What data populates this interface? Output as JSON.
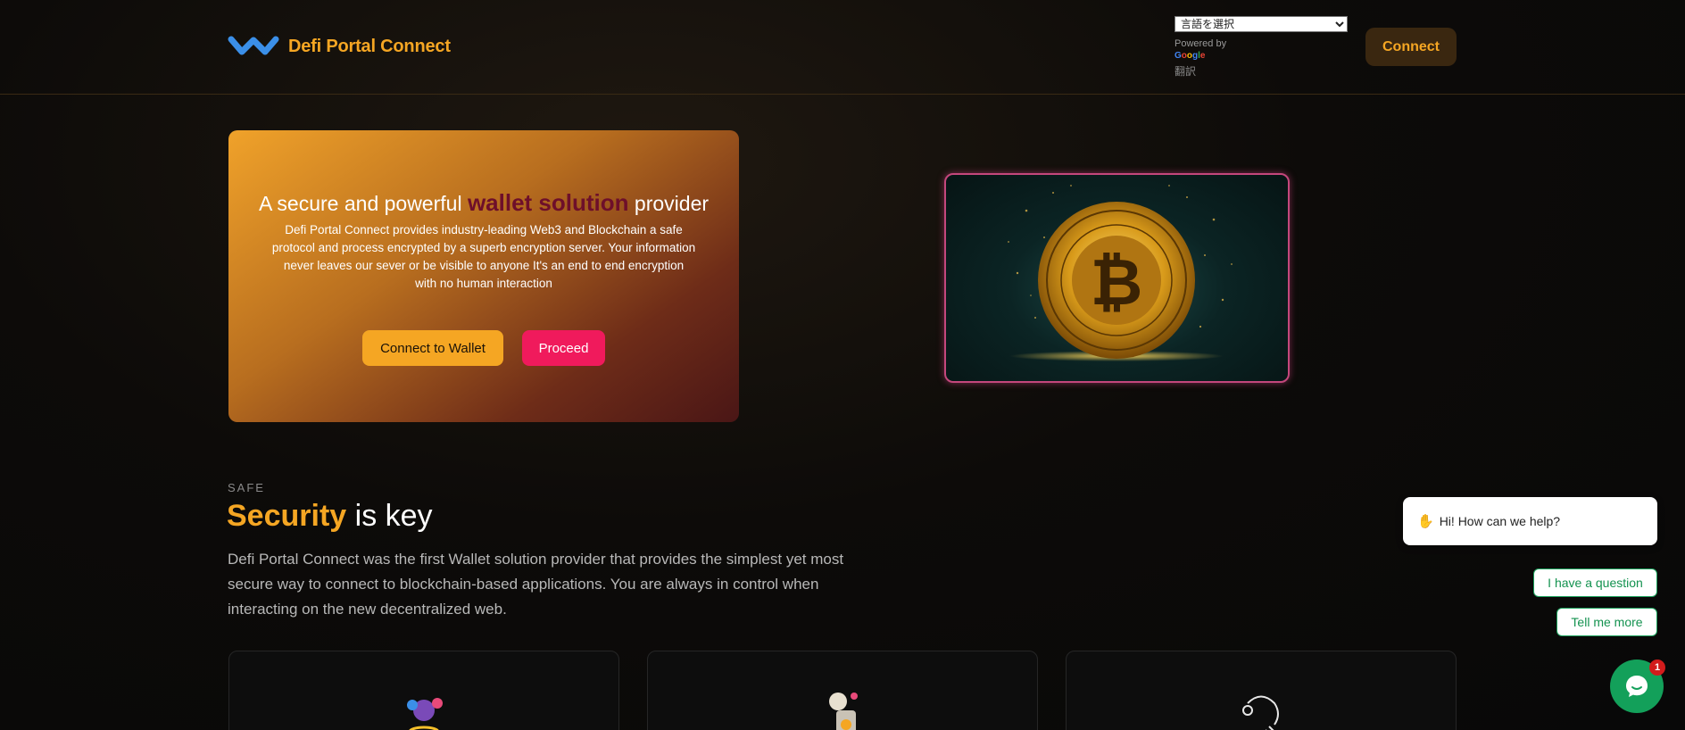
{
  "header": {
    "brand": "Defi Portal Connect",
    "language_select_value": "言語を選択",
    "powered_by": "Powered by",
    "google": [
      "G",
      "o",
      "o",
      "g",
      "l",
      "e"
    ],
    "translate_link": "翻訳",
    "connect_label": "Connect"
  },
  "hero": {
    "title_before": "A secure and powerful ",
    "title_highlight": "wallet solution",
    "title_after": " provider",
    "description": "Defi Portal Connect provides industry-leading Web3 and Blockchain a safe protocol and process encrypted by a superb encryption server. Your information never leaves our sever or be visible to anyone It's an end to end encryption with no human interaction",
    "wallet_button": "Connect to Wallet",
    "proceed_button": "Proceed"
  },
  "security": {
    "eyebrow": "SAFE",
    "title_accent": "Security",
    "title_rest": " is key",
    "description": "Defi Portal Connect was the first Wallet solution provider that provides the simplest yet most secure way to connect to blockchain-based applications. You are always in control when interacting on the new decentralized web."
  },
  "chat": {
    "greeting": "Hi! How can we help?",
    "option_1": "I have a question",
    "option_2": "Tell me more",
    "badge_count": "1"
  },
  "colors": {
    "accent": "#f5a623",
    "proceed": "#f01a5c",
    "chat_green": "#13a05a"
  }
}
